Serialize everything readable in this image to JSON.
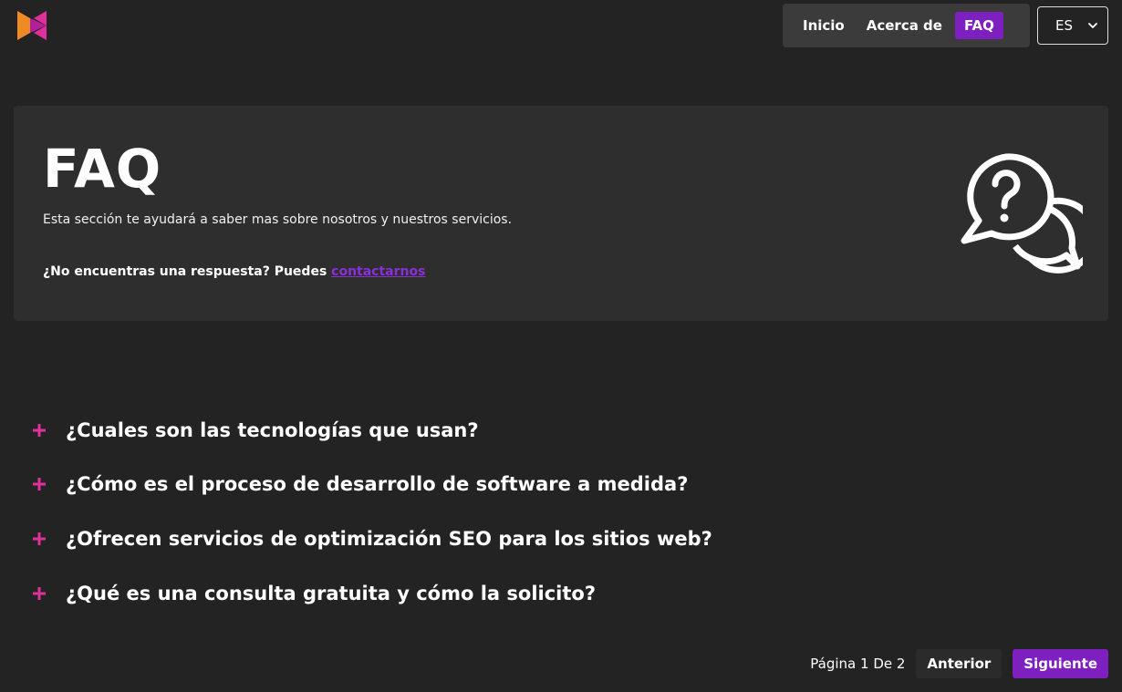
{
  "brand": {
    "logo_icon": "k-logo-icon",
    "colors": {
      "orange": "#f08a24",
      "pink": "#e0309a",
      "purple": "#7e1fc0"
    }
  },
  "nav": {
    "items": [
      {
        "label": "Inicio",
        "active": false
      },
      {
        "label": "Acerca de",
        "active": false
      },
      {
        "label": "FAQ",
        "active": true
      }
    ]
  },
  "language": {
    "selected": "ES",
    "icon": "chevron-down-icon"
  },
  "hero": {
    "title": "FAQ",
    "description": "Esta sección te ayudará a saber mas sobre nosotros y nuestros servicios.",
    "contact_prefix": "¿No encuentras una respuesta? Puedes ",
    "contact_link": "contactarnos",
    "icon": "question-chat-bubbles-icon"
  },
  "faq": {
    "accent": "#e0309a",
    "items": [
      {
        "question": "¿Cuales son las tecnologías que usan?",
        "icon": "plus-icon"
      },
      {
        "question": "¿Cómo es el proceso de desarrollo de software a medida?",
        "icon": "plus-icon"
      },
      {
        "question": "¿Ofrecen servicios de optimización SEO para los sitios web?",
        "icon": "plus-icon"
      },
      {
        "question": "¿Qué es una consulta gratuita y cómo la solicito?",
        "icon": "plus-icon"
      }
    ]
  },
  "pagination": {
    "info": "Página 1 De 2",
    "prev_label": "Anterior",
    "next_label": "Siguiente"
  }
}
